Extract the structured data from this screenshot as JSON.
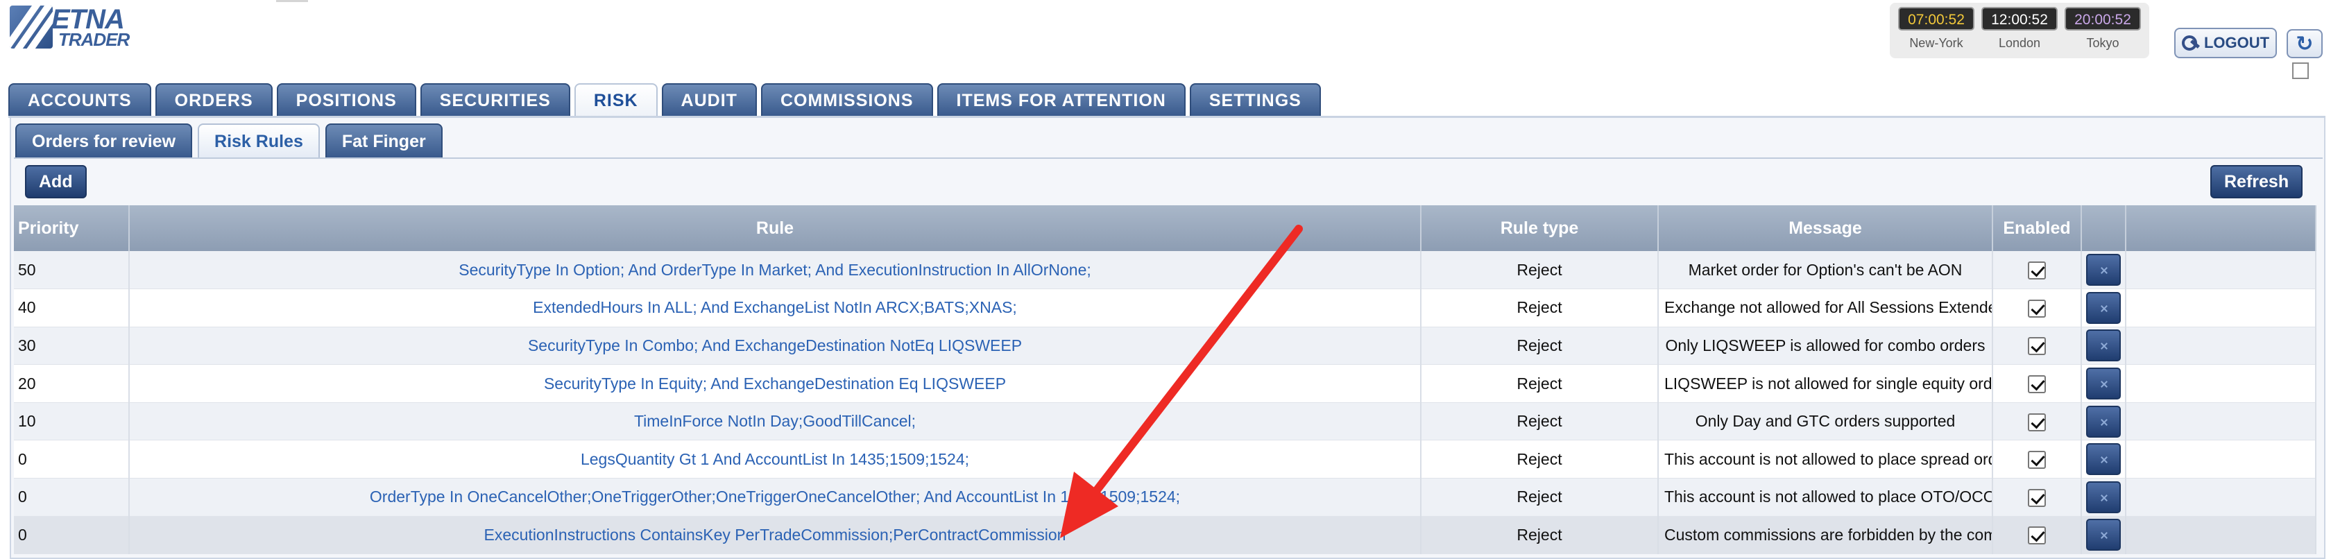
{
  "header": {
    "logo_line1": "ETNA",
    "logo_line2": "TRADER",
    "clocks": [
      {
        "time": "07:00:52",
        "city": "New-York",
        "color": "#f2c83a"
      },
      {
        "time": "12:00:52",
        "city": "London",
        "color": "#ffffff"
      },
      {
        "time": "20:00:52",
        "city": "Tokyo",
        "color": "#c9a7e8"
      }
    ],
    "logout_label": "LOGOUT",
    "refresh_icon": "refresh-icon",
    "logout_icon": "key-icon"
  },
  "main_tabs": [
    {
      "label": "ACCOUNTS",
      "active": false
    },
    {
      "label": "ORDERS",
      "active": false
    },
    {
      "label": "POSITIONS",
      "active": false
    },
    {
      "label": "SECURITIES",
      "active": false
    },
    {
      "label": "RISK",
      "active": true
    },
    {
      "label": "AUDIT",
      "active": false
    },
    {
      "label": "COMMISSIONS",
      "active": false
    },
    {
      "label": "ITEMS FOR ATTENTION",
      "active": false
    },
    {
      "label": "SETTINGS",
      "active": false
    }
  ],
  "sub_tabs": [
    {
      "label": "Orders for review",
      "active": false
    },
    {
      "label": "Risk Rules",
      "active": true
    },
    {
      "label": "Fat Finger",
      "active": false
    }
  ],
  "toolbar": {
    "add_label": "Add",
    "refresh_label": "Refresh"
  },
  "table": {
    "columns": [
      "Priority",
      "Rule",
      "Rule type",
      "Message",
      "Enabled"
    ],
    "rows": [
      {
        "priority": "50",
        "rule": "SecurityType In Option; And OrderType In Market; And ExecutionInstruction In AllOrNone;",
        "type": "Reject",
        "message": "Market order for Option's can't be AON",
        "enabled": true
      },
      {
        "priority": "40",
        "rule": "ExtendedHours In ALL; And ExchangeList NotIn ARCX;BATS;XNAS;",
        "type": "Reject",
        "message": "Exchange not allowed for All Sessions Extended",
        "enabled": true
      },
      {
        "priority": "30",
        "rule": "SecurityType In Combo; And ExchangeDestination NotEq LIQSWEEP",
        "type": "Reject",
        "message": "Only LIQSWEEP is allowed for combo orders",
        "enabled": true
      },
      {
        "priority": "20",
        "rule": "SecurityType In Equity; And ExchangeDestination Eq LIQSWEEP",
        "type": "Reject",
        "message": "LIQSWEEP is not allowed for single equity orders",
        "enabled": true
      },
      {
        "priority": "10",
        "rule": "TimeInForce NotIn Day;GoodTillCancel;",
        "type": "Reject",
        "message": "Only Day and GTC orders supported",
        "enabled": true
      },
      {
        "priority": "0",
        "rule": "LegsQuantity Gt 1 And AccountList In 1435;1509;1524;",
        "type": "Reject",
        "message": "This account is not allowed to place spread orders",
        "enabled": true
      },
      {
        "priority": "0",
        "rule": "OrderType In OneCancelOther;OneTriggerOther;OneTriggerOneCancelOther; And AccountList In 1435;1509;1524;",
        "type": "Reject",
        "message": "This account is not allowed to place OTO/OCO orders",
        "enabled": true
      },
      {
        "priority": "0",
        "rule": "ExecutionInstructions ContainsKey PerTradeCommission;PerContractCommission",
        "type": "Reject",
        "message": "Custom commissions are forbidden by the compliance",
        "enabled": true
      }
    ]
  },
  "annotation": {
    "type": "red-arrow",
    "color": "#ee2a24"
  }
}
